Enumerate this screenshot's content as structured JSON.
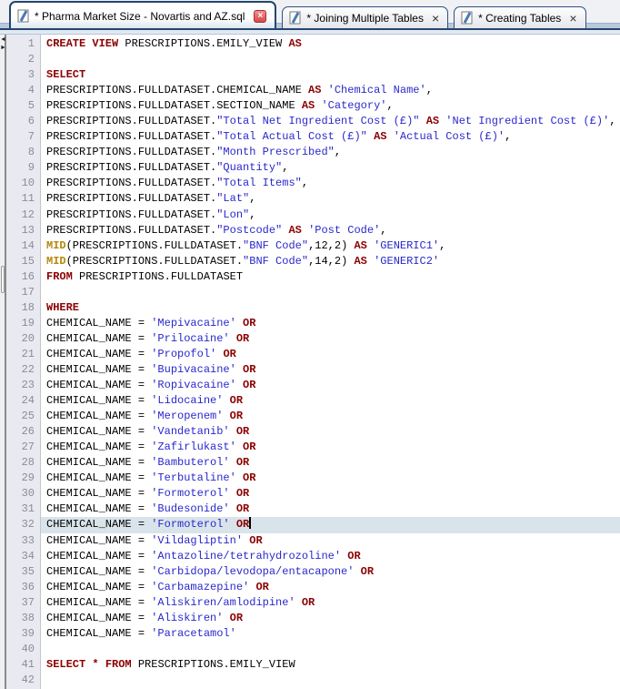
{
  "tabs": [
    {
      "label": "* Pharma Market Size - Novartis and AZ.sql",
      "active": true,
      "close_icon": "red-close-box"
    },
    {
      "label": "* Joining Multiple Tables",
      "active": false,
      "close_icon": "x"
    },
    {
      "label": "* Creating Tables",
      "active": false,
      "close_icon": "x"
    }
  ],
  "icons": {
    "tab_file": "sql-file-icon",
    "close_x_glyph": "×",
    "splitter_left_glyph": "◄",
    "splitter_right_glyph": "►"
  },
  "colors": {
    "keyword": "#8b0000",
    "function": "#b8860b",
    "string": "#2828cc",
    "plain": "#000000",
    "current_line_highlight": "#d9e4ea",
    "tab_border_navy": "#24466e",
    "gutter_bg": "#e9e9f1",
    "active_close_red": "#d84848"
  },
  "editor": {
    "current_line": 32,
    "caret_after_text": "OR",
    "lines": [
      {
        "n": 1,
        "tokens": [
          [
            "kw",
            "CREATE VIEW"
          ],
          [
            "pl",
            " PRESCRIPTIONS.EMILY_VIEW "
          ],
          [
            "kw",
            "AS"
          ]
        ]
      },
      {
        "n": 2,
        "tokens": []
      },
      {
        "n": 3,
        "tokens": [
          [
            "kw",
            "SELECT"
          ]
        ]
      },
      {
        "n": 4,
        "tokens": [
          [
            "pl",
            "PRESCRIPTIONS.FULLDATASET.CHEMICAL_NAME "
          ],
          [
            "kw",
            "AS"
          ],
          [
            "pl",
            " "
          ],
          [
            "str",
            "'Chemical Name'"
          ],
          [
            "pl",
            ","
          ]
        ]
      },
      {
        "n": 5,
        "tokens": [
          [
            "pl",
            "PRESCRIPTIONS.FULLDATASET.SECTION_NAME "
          ],
          [
            "kw",
            "AS"
          ],
          [
            "pl",
            " "
          ],
          [
            "str",
            "'Category'"
          ],
          [
            "pl",
            ","
          ]
        ]
      },
      {
        "n": 6,
        "tokens": [
          [
            "pl",
            "PRESCRIPTIONS.FULLDATASET."
          ],
          [
            "str",
            "\"Total Net Ingredient Cost (£)\""
          ],
          [
            "pl",
            " "
          ],
          [
            "kw",
            "AS"
          ],
          [
            "pl",
            " "
          ],
          [
            "str",
            "'Net Ingredient Cost (£)'"
          ],
          [
            "pl",
            ","
          ]
        ]
      },
      {
        "n": 7,
        "tokens": [
          [
            "pl",
            "PRESCRIPTIONS.FULLDATASET."
          ],
          [
            "str",
            "\"Total Actual Cost (£)\""
          ],
          [
            "pl",
            " "
          ],
          [
            "kw",
            "AS"
          ],
          [
            "pl",
            " "
          ],
          [
            "str",
            "'Actual Cost (£)'"
          ],
          [
            "pl",
            ","
          ]
        ]
      },
      {
        "n": 8,
        "tokens": [
          [
            "pl",
            "PRESCRIPTIONS.FULLDATASET."
          ],
          [
            "str",
            "\"Month Prescribed\""
          ],
          [
            "pl",
            ","
          ]
        ]
      },
      {
        "n": 9,
        "tokens": [
          [
            "pl",
            "PRESCRIPTIONS.FULLDATASET."
          ],
          [
            "str",
            "\"Quantity\""
          ],
          [
            "pl",
            ","
          ]
        ]
      },
      {
        "n": 10,
        "tokens": [
          [
            "pl",
            "PRESCRIPTIONS.FULLDATASET."
          ],
          [
            "str",
            "\"Total Items\""
          ],
          [
            "pl",
            ","
          ]
        ]
      },
      {
        "n": 11,
        "tokens": [
          [
            "pl",
            "PRESCRIPTIONS.FULLDATASET."
          ],
          [
            "str",
            "\"Lat\""
          ],
          [
            "pl",
            ","
          ]
        ]
      },
      {
        "n": 12,
        "tokens": [
          [
            "pl",
            "PRESCRIPTIONS.FULLDATASET."
          ],
          [
            "str",
            "\"Lon\""
          ],
          [
            "pl",
            ","
          ]
        ]
      },
      {
        "n": 13,
        "tokens": [
          [
            "pl",
            "PRESCRIPTIONS.FULLDATASET."
          ],
          [
            "str",
            "\"Postcode\""
          ],
          [
            "pl",
            " "
          ],
          [
            "kw",
            "AS"
          ],
          [
            "pl",
            " "
          ],
          [
            "str",
            "'Post Code'"
          ],
          [
            "pl",
            ","
          ]
        ]
      },
      {
        "n": 14,
        "tokens": [
          [
            "fn",
            "MID"
          ],
          [
            "pl",
            "(PRESCRIPTIONS.FULLDATASET."
          ],
          [
            "str",
            "\"BNF Code\""
          ],
          [
            "pl",
            ",12,2) "
          ],
          [
            "kw",
            "AS"
          ],
          [
            "pl",
            " "
          ],
          [
            "str",
            "'GENERIC1'"
          ],
          [
            "pl",
            ","
          ]
        ]
      },
      {
        "n": 15,
        "tokens": [
          [
            "fn",
            "MID"
          ],
          [
            "pl",
            "(PRESCRIPTIONS.FULLDATASET."
          ],
          [
            "str",
            "\"BNF Code\""
          ],
          [
            "pl",
            ",14,2) "
          ],
          [
            "kw",
            "AS"
          ],
          [
            "pl",
            " "
          ],
          [
            "str",
            "'GENERIC2'"
          ]
        ]
      },
      {
        "n": 16,
        "tokens": [
          [
            "kw",
            "FROM"
          ],
          [
            "pl",
            " PRESCRIPTIONS.FULLDATASET"
          ]
        ]
      },
      {
        "n": 17,
        "tokens": []
      },
      {
        "n": 18,
        "tokens": [
          [
            "kw",
            "WHERE"
          ]
        ]
      },
      {
        "n": 19,
        "tokens": [
          [
            "pl",
            "CHEMICAL_NAME = "
          ],
          [
            "str",
            "'Mepivacaine'"
          ],
          [
            "pl",
            " "
          ],
          [
            "kw",
            "OR"
          ]
        ]
      },
      {
        "n": 20,
        "tokens": [
          [
            "pl",
            "CHEMICAL_NAME = "
          ],
          [
            "str",
            "'Prilocaine'"
          ],
          [
            "pl",
            " "
          ],
          [
            "kw",
            "OR"
          ]
        ]
      },
      {
        "n": 21,
        "tokens": [
          [
            "pl",
            "CHEMICAL_NAME = "
          ],
          [
            "str",
            "'Propofol'"
          ],
          [
            "pl",
            " "
          ],
          [
            "kw",
            "OR"
          ]
        ]
      },
      {
        "n": 22,
        "tokens": [
          [
            "pl",
            "CHEMICAL_NAME = "
          ],
          [
            "str",
            "'Bupivacaine'"
          ],
          [
            "pl",
            " "
          ],
          [
            "kw",
            "OR"
          ]
        ]
      },
      {
        "n": 23,
        "tokens": [
          [
            "pl",
            "CHEMICAL_NAME = "
          ],
          [
            "str",
            "'Ropivacaine'"
          ],
          [
            "pl",
            " "
          ],
          [
            "kw",
            "OR"
          ]
        ]
      },
      {
        "n": 24,
        "tokens": [
          [
            "pl",
            "CHEMICAL_NAME = "
          ],
          [
            "str",
            "'Lidocaine'"
          ],
          [
            "pl",
            " "
          ],
          [
            "kw",
            "OR"
          ]
        ]
      },
      {
        "n": 25,
        "tokens": [
          [
            "pl",
            "CHEMICAL_NAME = "
          ],
          [
            "str",
            "'Meropenem'"
          ],
          [
            "pl",
            " "
          ],
          [
            "kw",
            "OR"
          ]
        ]
      },
      {
        "n": 26,
        "tokens": [
          [
            "pl",
            "CHEMICAL_NAME = "
          ],
          [
            "str",
            "'Vandetanib'"
          ],
          [
            "pl",
            " "
          ],
          [
            "kw",
            "OR"
          ]
        ]
      },
      {
        "n": 27,
        "tokens": [
          [
            "pl",
            "CHEMICAL_NAME = "
          ],
          [
            "str",
            "'Zafirlukast'"
          ],
          [
            "pl",
            " "
          ],
          [
            "kw",
            "OR"
          ]
        ]
      },
      {
        "n": 28,
        "tokens": [
          [
            "pl",
            "CHEMICAL_NAME = "
          ],
          [
            "str",
            "'Bambuterol'"
          ],
          [
            "pl",
            " "
          ],
          [
            "kw",
            "OR"
          ]
        ]
      },
      {
        "n": 29,
        "tokens": [
          [
            "pl",
            "CHEMICAL_NAME = "
          ],
          [
            "str",
            "'Terbutaline'"
          ],
          [
            "pl",
            " "
          ],
          [
            "kw",
            "OR"
          ]
        ]
      },
      {
        "n": 30,
        "tokens": [
          [
            "pl",
            "CHEMICAL_NAME = "
          ],
          [
            "str",
            "'Formoterol'"
          ],
          [
            "pl",
            " "
          ],
          [
            "kw",
            "OR"
          ]
        ]
      },
      {
        "n": 31,
        "tokens": [
          [
            "pl",
            "CHEMICAL_NAME = "
          ],
          [
            "str",
            "'Budesonide'"
          ],
          [
            "pl",
            " "
          ],
          [
            "kw",
            "OR"
          ]
        ]
      },
      {
        "n": 32,
        "tokens": [
          [
            "pl",
            "CHEMICAL_NAME = "
          ],
          [
            "str",
            "'Formoterol'"
          ],
          [
            "pl",
            " "
          ],
          [
            "kw",
            "OR"
          ]
        ]
      },
      {
        "n": 33,
        "tokens": [
          [
            "pl",
            "CHEMICAL_NAME = "
          ],
          [
            "str",
            "'Vildagliptin'"
          ],
          [
            "pl",
            " "
          ],
          [
            "kw",
            "OR"
          ]
        ]
      },
      {
        "n": 34,
        "tokens": [
          [
            "pl",
            "CHEMICAL_NAME = "
          ],
          [
            "str",
            "'Antazoline/tetrahydrozoline'"
          ],
          [
            "pl",
            " "
          ],
          [
            "kw",
            "OR"
          ]
        ]
      },
      {
        "n": 35,
        "tokens": [
          [
            "pl",
            "CHEMICAL_NAME = "
          ],
          [
            "str",
            "'Carbidopa/levodopa/entacapone'"
          ],
          [
            "pl",
            " "
          ],
          [
            "kw",
            "OR"
          ]
        ]
      },
      {
        "n": 36,
        "tokens": [
          [
            "pl",
            "CHEMICAL_NAME = "
          ],
          [
            "str",
            "'Carbamazepine'"
          ],
          [
            "pl",
            " "
          ],
          [
            "kw",
            "OR"
          ]
        ]
      },
      {
        "n": 37,
        "tokens": [
          [
            "pl",
            "CHEMICAL_NAME = "
          ],
          [
            "str",
            "'Aliskiren/amlodipine'"
          ],
          [
            "pl",
            " "
          ],
          [
            "kw",
            "OR"
          ]
        ]
      },
      {
        "n": 38,
        "tokens": [
          [
            "pl",
            "CHEMICAL_NAME = "
          ],
          [
            "str",
            "'Aliskiren'"
          ],
          [
            "pl",
            " "
          ],
          [
            "kw",
            "OR"
          ]
        ]
      },
      {
        "n": 39,
        "tokens": [
          [
            "pl",
            "CHEMICAL_NAME = "
          ],
          [
            "str",
            "'Paracetamol'"
          ]
        ]
      },
      {
        "n": 40,
        "tokens": []
      },
      {
        "n": 41,
        "tokens": [
          [
            "kw",
            "SELECT"
          ],
          [
            "pl",
            " "
          ],
          [
            "kw",
            "*"
          ],
          [
            "pl",
            " "
          ],
          [
            "kw",
            "FROM"
          ],
          [
            "pl",
            " PRESCRIPTIONS.EMILY_VIEW"
          ]
        ]
      },
      {
        "n": 42,
        "tokens": []
      }
    ]
  }
}
